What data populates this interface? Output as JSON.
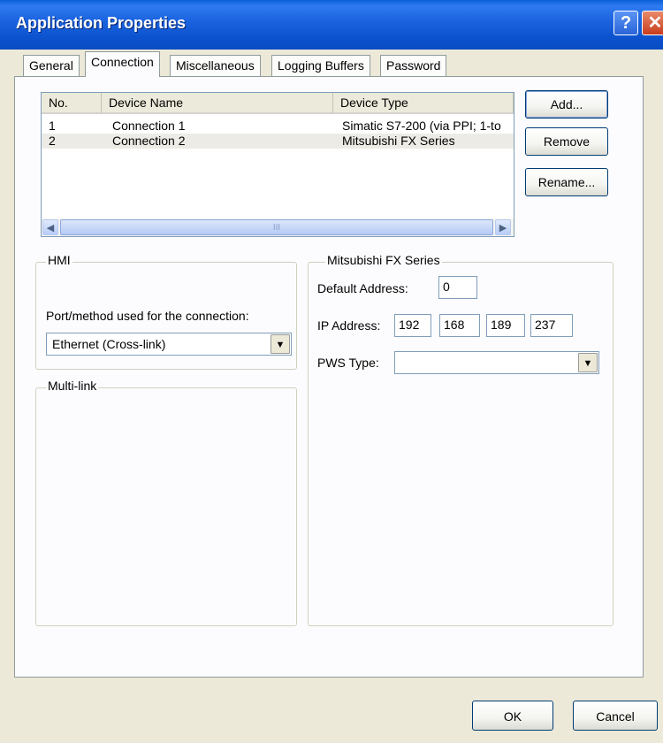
{
  "window": {
    "title": "Application Properties",
    "help_glyph": "?",
    "close_glyph": "✕"
  },
  "tabs": [
    "General",
    "Connection",
    "Miscellaneous",
    "Logging Buffers",
    "Password"
  ],
  "connections": {
    "columns": [
      "No.",
      "Device Name",
      "Device Type"
    ],
    "rows": [
      {
        "no": "1",
        "name": "Connection 1",
        "type": "Simatic S7-200 (via PPI; 1-to"
      },
      {
        "no": "2",
        "name": "Connection 2",
        "type": "Mitsubishi FX Series"
      }
    ],
    "scroll_grip": "III"
  },
  "side_buttons": {
    "add": "Add...",
    "remove": "Remove",
    "rename": "Rename..."
  },
  "hmi": {
    "group_label": "HMI",
    "port_label": "Port/method used for the connection:",
    "port_value": "Ethernet (Cross-link)"
  },
  "multilink": {
    "group_label": "Multi-link"
  },
  "device": {
    "group_label": "Mitsubishi FX Series",
    "default_address_label": "Default Address:",
    "default_address": "0",
    "ip_label": "IP Address:",
    "ip": [
      "192",
      "168",
      "189",
      "237"
    ],
    "pws_label": "PWS Type:",
    "pws_value": ""
  },
  "footer": {
    "ok": "OK",
    "cancel": "Cancel"
  }
}
